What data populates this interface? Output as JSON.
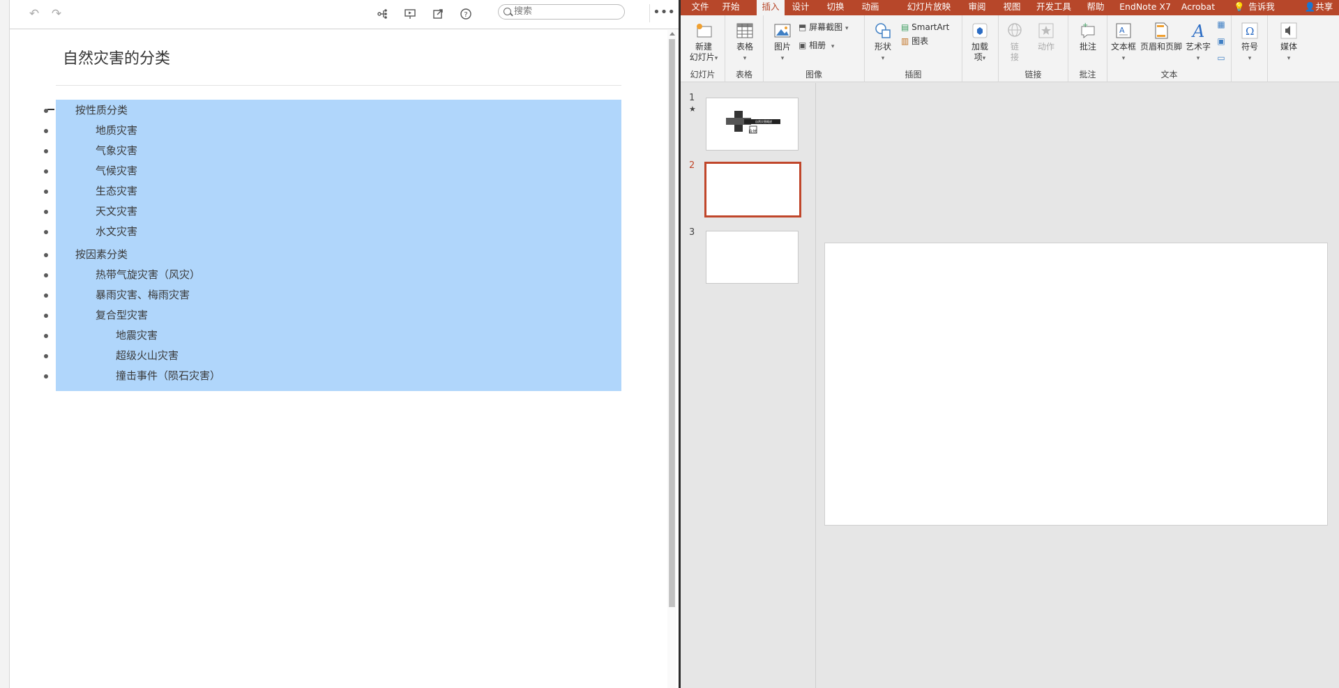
{
  "left_app": {
    "toolbar": {
      "undo_icon": "undo-icon",
      "redo_icon": "redo-icon",
      "search_placeholder": "搜索"
    },
    "doc_title": "自然灾害的分类",
    "outline": {
      "group1": {
        "label": "按性质分类",
        "items": [
          "地质灾害",
          "气象灾害",
          "气候灾害",
          "生态灾害",
          "天文灾害",
          "水文灾害"
        ]
      },
      "group2": {
        "label": "按因素分类",
        "items": [
          "热带气旋灾害（风灾）",
          "暴雨灾害、梅雨灾害",
          "复合型灾害"
        ],
        "sub_items": [
          "地震灾害",
          "超级火山灾害",
          "撞击事件（陨石灾害）"
        ]
      }
    }
  },
  "ppt": {
    "tabs": [
      "文件",
      "开始",
      "插入",
      "设计",
      "切换",
      "动画",
      "幻灯片放映",
      "审阅",
      "视图",
      "开发工具",
      "帮助",
      "EndNote X7",
      "Acrobat",
      "告诉我",
      "共享"
    ],
    "active_tab": "插入",
    "ribbon": {
      "new_slide": "新建",
      "new_slide2": "幻灯片",
      "table": "表格",
      "picture": "图片",
      "screenshot": "屏幕截图",
      "album": "相册",
      "shapes": "形状",
      "smartart": "SmartArt",
      "chart": "图表",
      "addins": "加载",
      "addins2": "项",
      "link": "链",
      "link2": "接",
      "action": "动作",
      "comment": "批注",
      "textbox": "文本框",
      "header_footer": "页眉和页脚",
      "wordart": "艺术字",
      "symbol": "符号",
      "media": "媒体",
      "groups": {
        "slides": "幻灯片",
        "tables": "表格",
        "images": "图像",
        "illustrations": "插图",
        "links": "链接",
        "comments": "批注",
        "text": "文本"
      }
    },
    "slides": [
      {
        "num": "1",
        "star": "★",
        "title": "自然灾害概述",
        "sub": "自然"
      },
      {
        "num": "2"
      },
      {
        "num": "3"
      }
    ],
    "colors": {
      "accent": "#b7472a",
      "selection": "#b0d6fb"
    }
  }
}
